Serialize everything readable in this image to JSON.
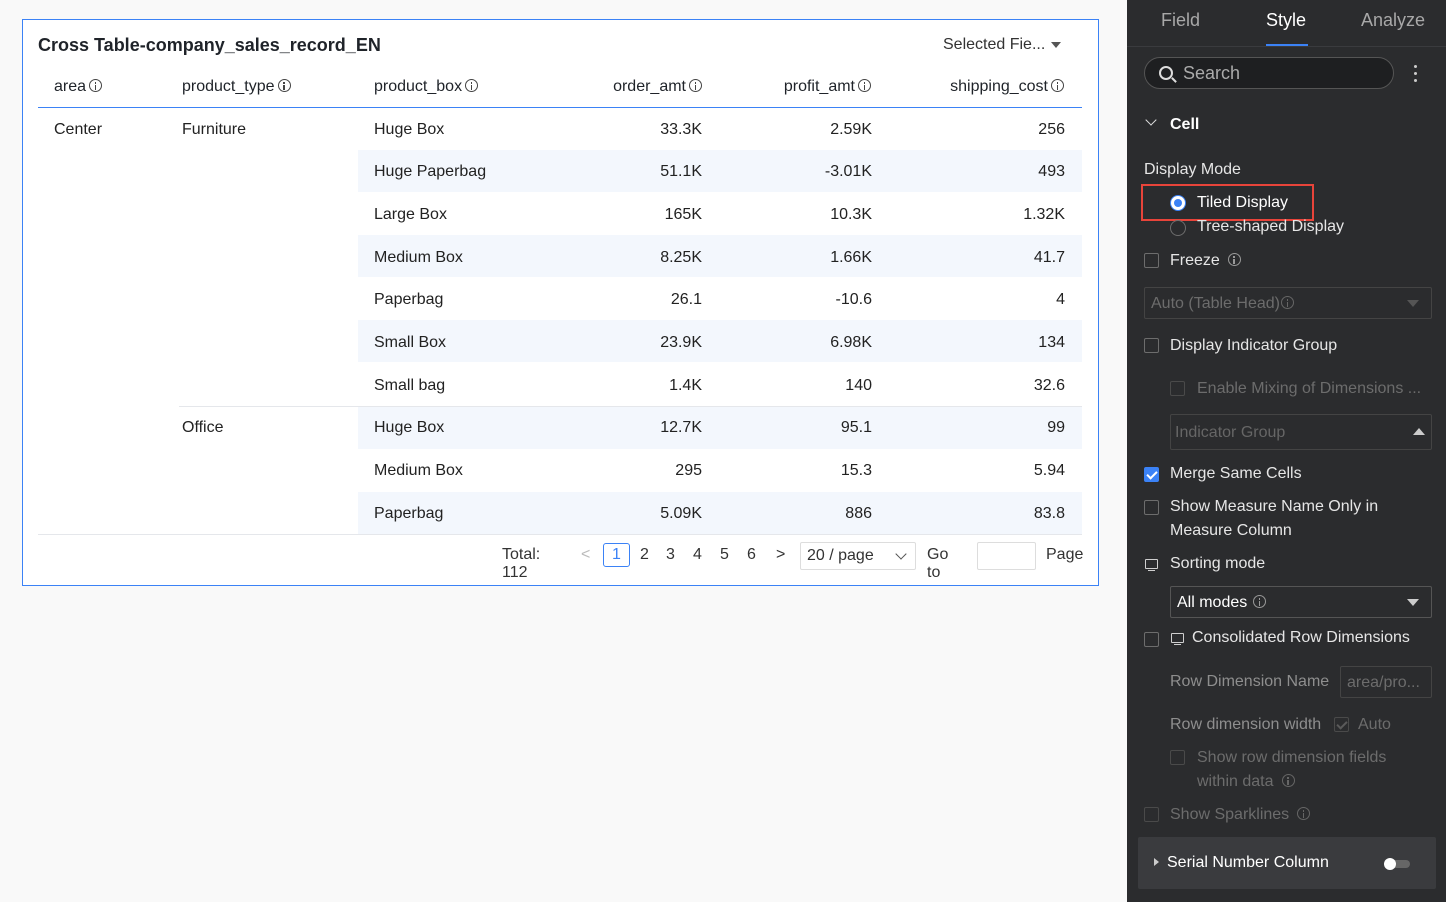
{
  "card": {
    "title": "Cross Table-company_sales_record_EN",
    "selected_fields": "Selected Fie..."
  },
  "table": {
    "headers": [
      "area",
      "product_type",
      "product_box",
      "order_amt",
      "profit_amt",
      "shipping_cost"
    ],
    "area": "Center",
    "product_types": [
      "Furniture",
      "Office"
    ],
    "rows": [
      {
        "box": "Huge Box",
        "order": "33.3K",
        "profit": "2.59K",
        "ship": "256"
      },
      {
        "box": "Huge Paperbag",
        "order": "51.1K",
        "profit": "-3.01K",
        "ship": "493"
      },
      {
        "box": "Large Box",
        "order": "165K",
        "profit": "10.3K",
        "ship": "1.32K"
      },
      {
        "box": "Medium Box",
        "order": "8.25K",
        "profit": "1.66K",
        "ship": "41.7"
      },
      {
        "box": "Paperbag",
        "order": "26.1",
        "profit": "-10.6",
        "ship": "4"
      },
      {
        "box": "Small Box",
        "order": "23.9K",
        "profit": "6.98K",
        "ship": "134"
      },
      {
        "box": "Small bag",
        "order": "1.4K",
        "profit": "140",
        "ship": "32.6"
      },
      {
        "box": "Huge Box",
        "order": "12.7K",
        "profit": "95.1",
        "ship": "99"
      },
      {
        "box": "Medium Box",
        "order": "295",
        "profit": "15.3",
        "ship": "5.94"
      },
      {
        "box": "Paperbag",
        "order": "5.09K",
        "profit": "886",
        "ship": "83.8"
      }
    ]
  },
  "pagination": {
    "total": "Total: 112",
    "pages": [
      "1",
      "2",
      "3",
      "4",
      "5",
      "6"
    ],
    "current_page": "1",
    "page_size": "20 / page",
    "goto_label": "Go to",
    "page_label": "Page"
  },
  "panel": {
    "tabs": [
      "Field",
      "Style",
      "Analyze"
    ],
    "active_tab": "Style",
    "search_placeholder": "Search",
    "section_title": "Cell",
    "display_mode_label": "Display Mode",
    "tiled_display": "Tiled Display",
    "tree_display": "Tree-shaped Display",
    "freeze": "Freeze",
    "freeze_select": "Auto (Table Head)",
    "display_indicator_group": "Display Indicator Group",
    "enable_mixing": "Enable Mixing of Dimensions ...",
    "indicator_group_placeholder": "Indicator Group",
    "merge_same_cells": "Merge Same Cells",
    "show_measure_name_line1": "Show Measure Name Only in",
    "show_measure_name_line2": "Measure Column",
    "sorting_mode": "Sorting mode",
    "sorting_select": "All modes",
    "consolidated_row_dims": "Consolidated Row Dimensions",
    "row_dim_name_label": "Row Dimension Name",
    "row_dim_name_value": "area/pro...",
    "row_dim_width_label": "Row dimension width",
    "auto_label": "Auto",
    "show_row_fields_line1": "Show row dimension fields",
    "show_row_fields_line2": "within data",
    "show_sparklines": "Show Sparklines",
    "serial_number_column": "Serial Number Column"
  },
  "colors": {
    "accent": "#3b82f6",
    "highlight": "#e8443a",
    "panel_bg": "#2b2c2e",
    "stripe": "#f3f7fd"
  }
}
